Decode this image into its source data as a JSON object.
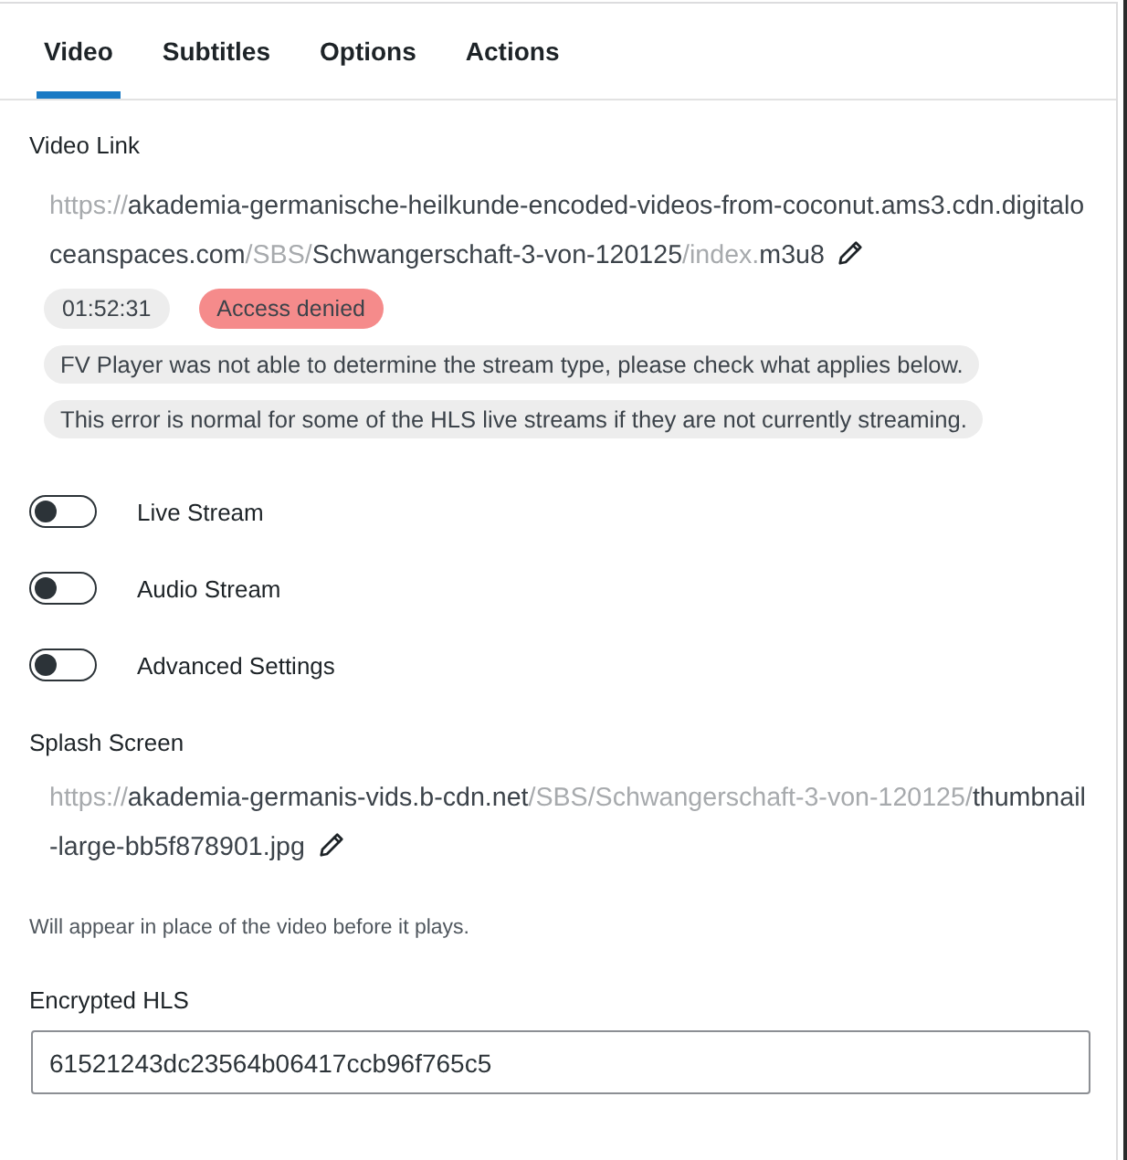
{
  "tabs": [
    {
      "label": "Video",
      "selected": true
    },
    {
      "label": "Subtitles",
      "selected": false
    },
    {
      "label": "Options",
      "selected": false
    },
    {
      "label": "Actions",
      "selected": false
    }
  ],
  "video_link": {
    "label": "Video Link",
    "url": [
      {
        "text": "https://",
        "muted": true
      },
      {
        "text": "akademia-germanische-heilkunde-encoded-videos-from-coconut.ams3.cdn.digitaloceanspaces.com",
        "muted": false
      },
      {
        "text": "/SBS/",
        "muted": true
      },
      {
        "text": "Schwangerschaft-3-von-120125",
        "muted": false
      },
      {
        "text": "/index.",
        "muted": true
      },
      {
        "text": "m3u8",
        "muted": false
      }
    ],
    "badges": [
      {
        "text": "01:52:31",
        "kind": "info"
      },
      {
        "text": "Access denied",
        "kind": "error"
      }
    ],
    "notices": [
      "FV Player was not able to determine the stream type, please check what applies below.",
      "This error is normal for some of the HLS live streams if they are not currently streaming."
    ]
  },
  "toggles": [
    {
      "label": "Live Stream",
      "on": false
    },
    {
      "label": "Audio Stream",
      "on": false
    },
    {
      "label": "Advanced Settings",
      "on": false
    }
  ],
  "splash_screen": {
    "label": "Splash Screen",
    "url": [
      {
        "text": "https://",
        "muted": true
      },
      {
        "text": "akademia-germanis-vids.b-cdn.net",
        "muted": false
      },
      {
        "text": "/SBS/Schwangerschaft-3-von-120125/",
        "muted": true
      },
      {
        "text": "thumbnail-large-bb5f878901.jpg",
        "muted": false
      }
    ],
    "hint": "Will appear in place of the video before it plays."
  },
  "encrypted_hls": {
    "label": "Encrypted HLS",
    "value": "61521243dc23564b06417ccb96f765c5"
  }
}
